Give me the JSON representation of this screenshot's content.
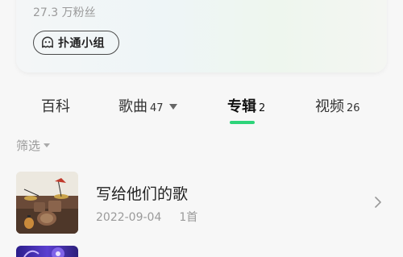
{
  "profile": {
    "fans_text": "27.3 万粉丝",
    "group_button_label": "扑通小组",
    "group_icon": "ghost-chat-icon"
  },
  "tabs": [
    {
      "label": "百科",
      "count": ""
    },
    {
      "label": "歌曲",
      "count": "47"
    },
    {
      "label": "专辑",
      "count": "2",
      "active": true
    },
    {
      "label": "视频",
      "count": "26"
    }
  ],
  "accent_color": "#2ed47a",
  "filter": {
    "label": "筛选"
  },
  "albums": [
    {
      "title": "写给他们的歌",
      "date": "2022-09-04",
      "track_count": "1首",
      "cover_icon": "drum-kit-photo"
    },
    {
      "title": "",
      "date": "",
      "track_count": "",
      "cover_icon": "purple-abstract-cover"
    }
  ]
}
